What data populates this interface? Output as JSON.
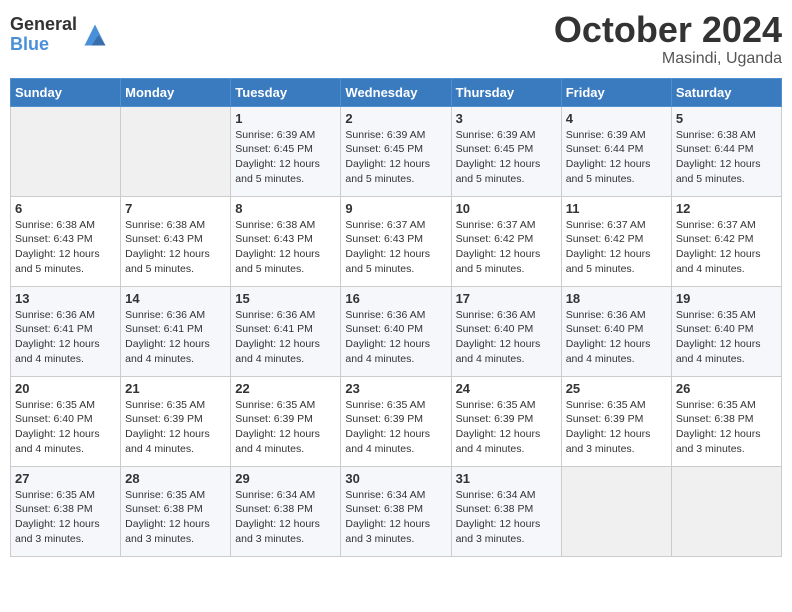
{
  "header": {
    "logo_general": "General",
    "logo_blue": "Blue",
    "month": "October 2024",
    "location": "Masindi, Uganda"
  },
  "days_of_week": [
    "Sunday",
    "Monday",
    "Tuesday",
    "Wednesday",
    "Thursday",
    "Friday",
    "Saturday"
  ],
  "weeks": [
    [
      {
        "day": "",
        "info": ""
      },
      {
        "day": "",
        "info": ""
      },
      {
        "day": "1",
        "info": "Sunrise: 6:39 AM\nSunset: 6:45 PM\nDaylight: 12 hours and 5 minutes."
      },
      {
        "day": "2",
        "info": "Sunrise: 6:39 AM\nSunset: 6:45 PM\nDaylight: 12 hours and 5 minutes."
      },
      {
        "day": "3",
        "info": "Sunrise: 6:39 AM\nSunset: 6:45 PM\nDaylight: 12 hours and 5 minutes."
      },
      {
        "day": "4",
        "info": "Sunrise: 6:39 AM\nSunset: 6:44 PM\nDaylight: 12 hours and 5 minutes."
      },
      {
        "day": "5",
        "info": "Sunrise: 6:38 AM\nSunset: 6:44 PM\nDaylight: 12 hours and 5 minutes."
      }
    ],
    [
      {
        "day": "6",
        "info": "Sunrise: 6:38 AM\nSunset: 6:43 PM\nDaylight: 12 hours and 5 minutes."
      },
      {
        "day": "7",
        "info": "Sunrise: 6:38 AM\nSunset: 6:43 PM\nDaylight: 12 hours and 5 minutes."
      },
      {
        "day": "8",
        "info": "Sunrise: 6:38 AM\nSunset: 6:43 PM\nDaylight: 12 hours and 5 minutes."
      },
      {
        "day": "9",
        "info": "Sunrise: 6:37 AM\nSunset: 6:43 PM\nDaylight: 12 hours and 5 minutes."
      },
      {
        "day": "10",
        "info": "Sunrise: 6:37 AM\nSunset: 6:42 PM\nDaylight: 12 hours and 5 minutes."
      },
      {
        "day": "11",
        "info": "Sunrise: 6:37 AM\nSunset: 6:42 PM\nDaylight: 12 hours and 5 minutes."
      },
      {
        "day": "12",
        "info": "Sunrise: 6:37 AM\nSunset: 6:42 PM\nDaylight: 12 hours and 4 minutes."
      }
    ],
    [
      {
        "day": "13",
        "info": "Sunrise: 6:36 AM\nSunset: 6:41 PM\nDaylight: 12 hours and 4 minutes."
      },
      {
        "day": "14",
        "info": "Sunrise: 6:36 AM\nSunset: 6:41 PM\nDaylight: 12 hours and 4 minutes."
      },
      {
        "day": "15",
        "info": "Sunrise: 6:36 AM\nSunset: 6:41 PM\nDaylight: 12 hours and 4 minutes."
      },
      {
        "day": "16",
        "info": "Sunrise: 6:36 AM\nSunset: 6:40 PM\nDaylight: 12 hours and 4 minutes."
      },
      {
        "day": "17",
        "info": "Sunrise: 6:36 AM\nSunset: 6:40 PM\nDaylight: 12 hours and 4 minutes."
      },
      {
        "day": "18",
        "info": "Sunrise: 6:36 AM\nSunset: 6:40 PM\nDaylight: 12 hours and 4 minutes."
      },
      {
        "day": "19",
        "info": "Sunrise: 6:35 AM\nSunset: 6:40 PM\nDaylight: 12 hours and 4 minutes."
      }
    ],
    [
      {
        "day": "20",
        "info": "Sunrise: 6:35 AM\nSunset: 6:40 PM\nDaylight: 12 hours and 4 minutes."
      },
      {
        "day": "21",
        "info": "Sunrise: 6:35 AM\nSunset: 6:39 PM\nDaylight: 12 hours and 4 minutes."
      },
      {
        "day": "22",
        "info": "Sunrise: 6:35 AM\nSunset: 6:39 PM\nDaylight: 12 hours and 4 minutes."
      },
      {
        "day": "23",
        "info": "Sunrise: 6:35 AM\nSunset: 6:39 PM\nDaylight: 12 hours and 4 minutes."
      },
      {
        "day": "24",
        "info": "Sunrise: 6:35 AM\nSunset: 6:39 PM\nDaylight: 12 hours and 4 minutes."
      },
      {
        "day": "25",
        "info": "Sunrise: 6:35 AM\nSunset: 6:39 PM\nDaylight: 12 hours and 3 minutes."
      },
      {
        "day": "26",
        "info": "Sunrise: 6:35 AM\nSunset: 6:38 PM\nDaylight: 12 hours and 3 minutes."
      }
    ],
    [
      {
        "day": "27",
        "info": "Sunrise: 6:35 AM\nSunset: 6:38 PM\nDaylight: 12 hours and 3 minutes."
      },
      {
        "day": "28",
        "info": "Sunrise: 6:35 AM\nSunset: 6:38 PM\nDaylight: 12 hours and 3 minutes."
      },
      {
        "day": "29",
        "info": "Sunrise: 6:34 AM\nSunset: 6:38 PM\nDaylight: 12 hours and 3 minutes."
      },
      {
        "day": "30",
        "info": "Sunrise: 6:34 AM\nSunset: 6:38 PM\nDaylight: 12 hours and 3 minutes."
      },
      {
        "day": "31",
        "info": "Sunrise: 6:34 AM\nSunset: 6:38 PM\nDaylight: 12 hours and 3 minutes."
      },
      {
        "day": "",
        "info": ""
      },
      {
        "day": "",
        "info": ""
      }
    ]
  ]
}
